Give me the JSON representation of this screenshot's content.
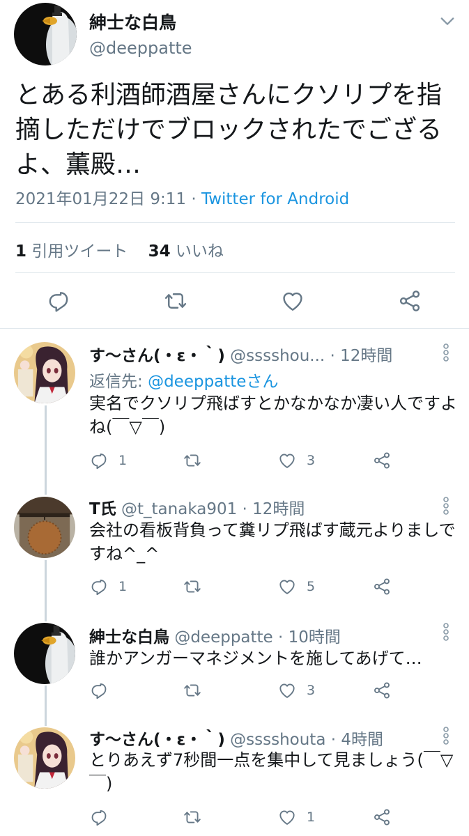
{
  "main_tweet": {
    "display_name": "紳士な白鳥",
    "handle": "@deeppatte",
    "text": "とある利酒師酒屋さんにクソリプを指摘しただけでブロックされたでござるよ、薫殿…",
    "timestamp": "2021年01月22日 9:11",
    "separator": " · ",
    "source": "Twitter for Android",
    "quote_count": "1",
    "quote_label": "引用ツイート",
    "like_count": "34",
    "like_label": "いいね"
  },
  "replies": [
    {
      "display_name": "す〜さん(・ε・｀)",
      "handle": "@sssshou...",
      "time": "· 12時間",
      "reply_to_prefix": "返信先: ",
      "reply_to_user": "@deeppatteさん",
      "text": "実名でクソリプ飛ばすとかなかなか凄い人ですよね(￣▽￣)",
      "reply_count": "1",
      "retweet_count": "",
      "like_count": "3"
    },
    {
      "display_name": "T氏",
      "handle": "@t_tanaka901",
      "time": "· 12時間",
      "text": "会社の看板背負って糞リプ飛ばす蔵元よりましですね^_^",
      "reply_count": "1",
      "retweet_count": "",
      "like_count": "5"
    },
    {
      "display_name": "紳士な白鳥",
      "handle": "@deeppatte",
      "time": "· 10時間",
      "text": "誰かアンガーマネジメントを施してあげて…",
      "reply_count": "",
      "retweet_count": "",
      "like_count": "3"
    },
    {
      "display_name": "す〜さん(・ε・｀)",
      "handle": "@sssshouta",
      "time": "· 4時間",
      "text": "とりあえず7秒間一点を集中して見ましょう(￣▽￣)",
      "reply_count": "",
      "retweet_count": "",
      "like_count": "1"
    }
  ],
  "icons": {
    "menu": "chevron-down-icon",
    "reply": "reply-icon",
    "retweet": "retweet-icon",
    "like": "heart-icon",
    "share": "share-icon",
    "more": "more-vertical-icon"
  },
  "colors": {
    "link": "#1b95e0",
    "secondary_text": "#657786",
    "divider": "#e1e8ed",
    "thread_line": "#ccd6dd"
  }
}
